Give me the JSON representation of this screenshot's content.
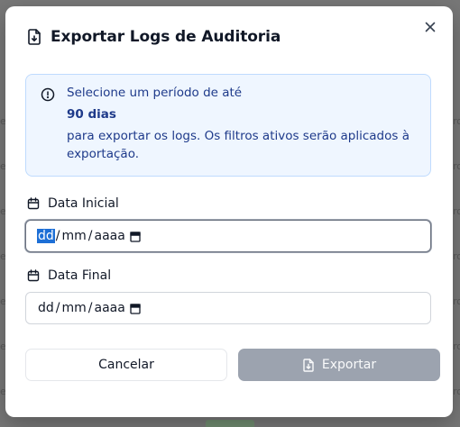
{
  "modal": {
    "title": "Exportar Logs de Auditoria",
    "close_label": "×"
  },
  "info": {
    "line1": "Selecione um período de até",
    "highlight": "90 dias",
    "line2": "para exportar os logs. Os filtros ativos serão aplicados à exportação."
  },
  "fields": {
    "start_label": "Data Inicial",
    "end_label": "Data Final",
    "start": {
      "dd": "dd",
      "mm": "mm",
      "yyyy": "aaaa",
      "sep": "/"
    },
    "end": {
      "dd": "dd",
      "mm": "mm",
      "yyyy": "aaaa",
      "sep": "/"
    }
  },
  "buttons": {
    "cancel": "Cancelar",
    "export": "Exportar",
    "export_disabled": true
  },
  "colors": {
    "info_bg": "#eff6ff",
    "info_text": "#1e3a8a",
    "export_disabled_bg": "#9ca3af",
    "selection": "#1d6fd6"
  },
  "icons": [
    "file-download-icon",
    "close-icon",
    "info-circle-icon",
    "calendar-icon"
  ]
}
